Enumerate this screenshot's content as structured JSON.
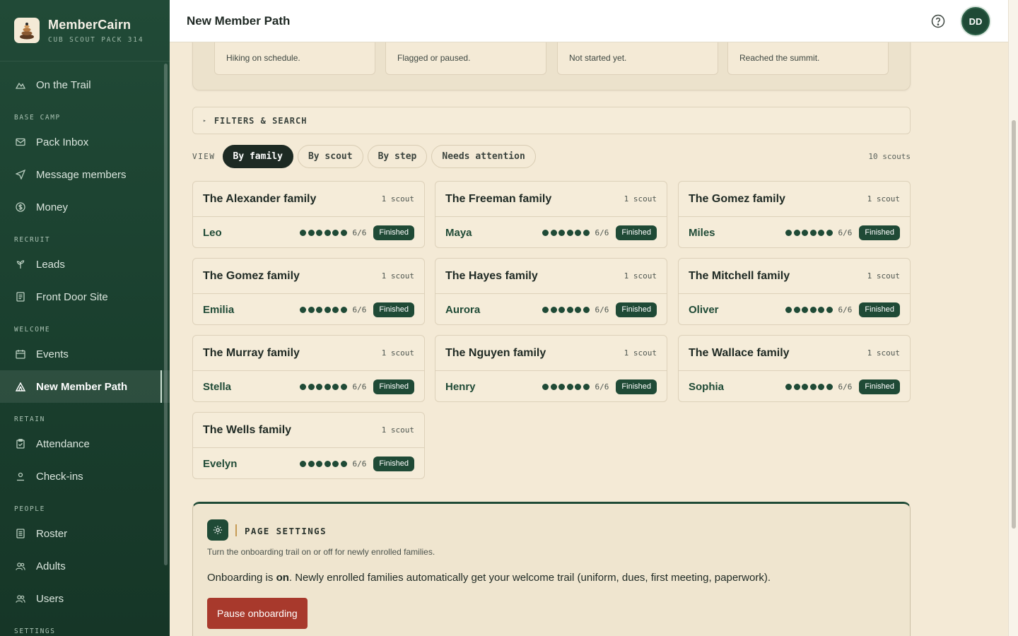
{
  "brand": {
    "name": "MemberCairn",
    "subtitle": "CUB SCOUT PACK 314"
  },
  "sidebar": {
    "top": {
      "label": "On the Trail",
      "icon": "mountain-icon"
    },
    "sections": [
      {
        "title": "BASE CAMP",
        "items": [
          {
            "label": "Pack Inbox",
            "icon": "mail-icon"
          },
          {
            "label": "Message members",
            "icon": "send-icon"
          },
          {
            "label": "Money",
            "icon": "dollar-icon"
          }
        ]
      },
      {
        "title": "RECRUIT",
        "items": [
          {
            "label": "Leads",
            "icon": "sprout-icon"
          },
          {
            "label": "Front Door Site",
            "icon": "page-icon"
          }
        ]
      },
      {
        "title": "WELCOME",
        "items": [
          {
            "label": "Events",
            "icon": "calendar-icon"
          },
          {
            "label": "New Member Path",
            "icon": "tent-icon",
            "active": true
          }
        ]
      },
      {
        "title": "RETAIN",
        "items": [
          {
            "label": "Attendance",
            "icon": "clipboard-icon"
          },
          {
            "label": "Check-ins",
            "icon": "person-icon"
          }
        ]
      },
      {
        "title": "PEOPLE",
        "items": [
          {
            "label": "Roster",
            "icon": "list-icon"
          },
          {
            "label": "Adults",
            "icon": "users-icon"
          },
          {
            "label": "Users",
            "icon": "users-icon"
          }
        ]
      },
      {
        "title": "SETTINGS",
        "items": []
      }
    ]
  },
  "header": {
    "title": "New Member Path",
    "avatar_initials": "DD"
  },
  "stats": [
    {
      "caption": "Hiking on schedule."
    },
    {
      "caption": "Flagged or paused."
    },
    {
      "caption": "Not started yet."
    },
    {
      "caption": "Reached the summit."
    }
  ],
  "filters": {
    "label": "FILTERS & SEARCH"
  },
  "view": {
    "label": "VIEW",
    "options": [
      "By family",
      "By scout",
      "By step",
      "Needs attention"
    ],
    "active": "By family",
    "count": "10 scouts"
  },
  "families": [
    {
      "name": "The Alexander family",
      "count": "1 scout",
      "scout": "Leo",
      "steps_done": 6,
      "steps_total": 6,
      "progress": "6/6",
      "status": "Finished"
    },
    {
      "name": "The Freeman family",
      "count": "1 scout",
      "scout": "Maya",
      "steps_done": 6,
      "steps_total": 6,
      "progress": "6/6",
      "status": "Finished"
    },
    {
      "name": "The Gomez family",
      "count": "1 scout",
      "scout": "Miles",
      "steps_done": 6,
      "steps_total": 6,
      "progress": "6/6",
      "status": "Finished"
    },
    {
      "name": "The Gomez family",
      "count": "1 scout",
      "scout": "Emilia",
      "steps_done": 6,
      "steps_total": 6,
      "progress": "6/6",
      "status": "Finished"
    },
    {
      "name": "The Hayes family",
      "count": "1 scout",
      "scout": "Aurora",
      "steps_done": 6,
      "steps_total": 6,
      "progress": "6/6",
      "status": "Finished"
    },
    {
      "name": "The Mitchell family",
      "count": "1 scout",
      "scout": "Oliver",
      "steps_done": 6,
      "steps_total": 6,
      "progress": "6/6",
      "status": "Finished"
    },
    {
      "name": "The Murray family",
      "count": "1 scout",
      "scout": "Stella",
      "steps_done": 6,
      "steps_total": 6,
      "progress": "6/6",
      "status": "Finished"
    },
    {
      "name": "The Nguyen family",
      "count": "1 scout",
      "scout": "Henry",
      "steps_done": 6,
      "steps_total": 6,
      "progress": "6/6",
      "status": "Finished"
    },
    {
      "name": "The Wallace family",
      "count": "1 scout",
      "scout": "Sophia",
      "steps_done": 6,
      "steps_total": 6,
      "progress": "6/6",
      "status": "Finished"
    },
    {
      "name": "The Wells family",
      "count": "1 scout",
      "scout": "Evelyn",
      "steps_done": 6,
      "steps_total": 6,
      "progress": "6/6",
      "status": "Finished"
    }
  ],
  "settings": {
    "title": "PAGE SETTINGS",
    "description": "Turn the onboarding trail on or off for newly enrolled families.",
    "status_prefix": "Onboarding is ",
    "status_value": "on",
    "status_suffix": ". Newly enrolled families automatically get your welcome trail (uniform, dues, first meeting, paperwork).",
    "button_label": "Pause onboarding"
  },
  "colors": {
    "sidebar": "#1a3f2e",
    "accent": "#1f4a36",
    "background": "#f4ead6",
    "danger": "#a8392c"
  }
}
